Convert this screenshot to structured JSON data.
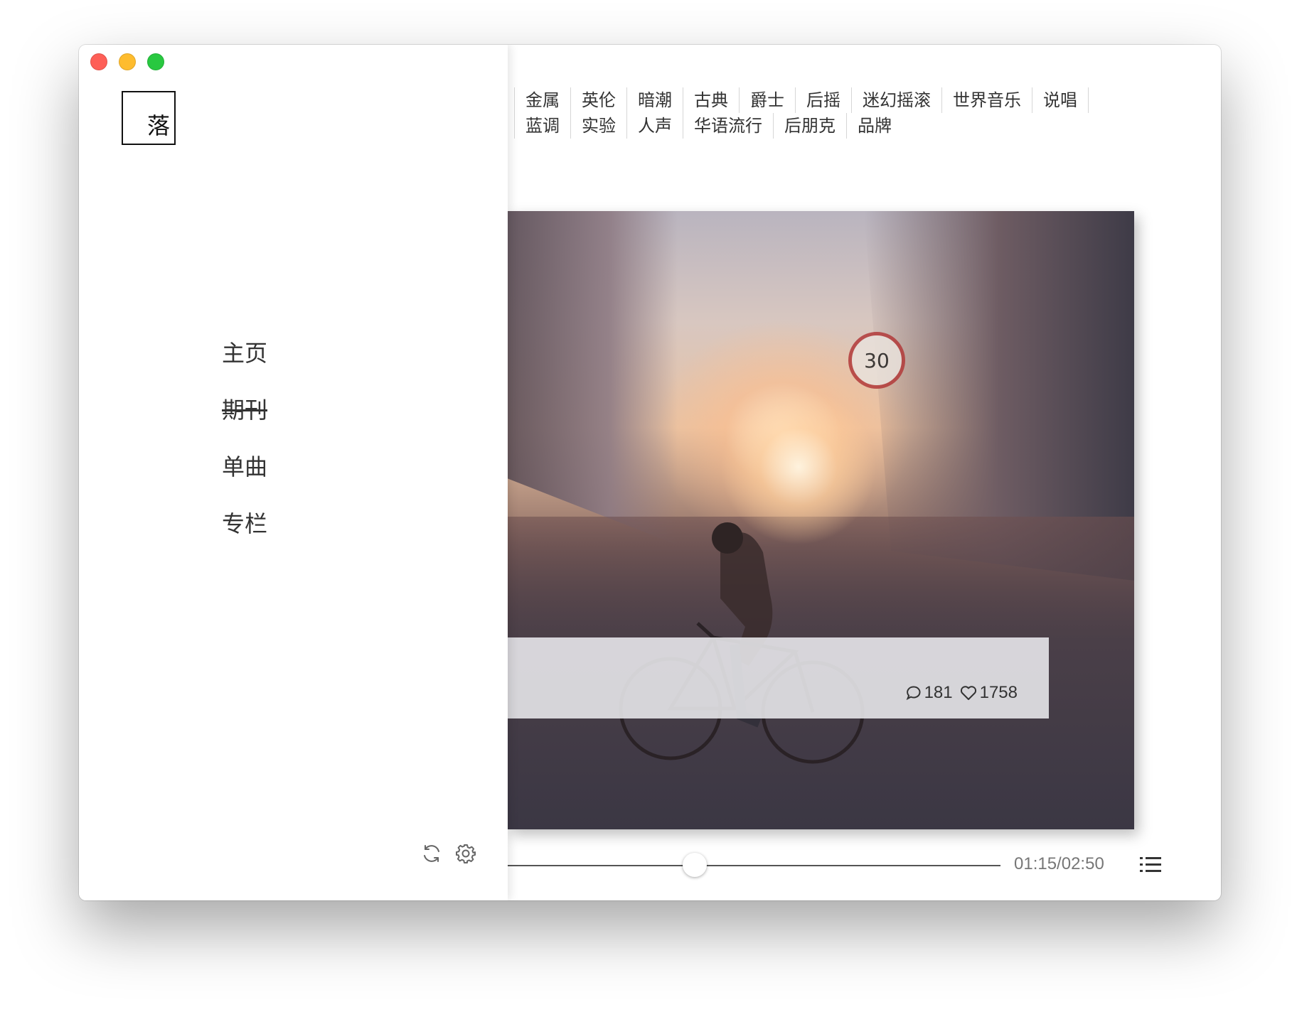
{
  "window": {
    "app_char": "落"
  },
  "genres": {
    "row1": [
      "金属",
      "英伦",
      "暗潮",
      "古典",
      "爵士",
      "后摇",
      "迷幻摇滚",
      "世界音乐",
      "说唱"
    ],
    "row2": [
      "蓝调",
      "实验",
      "人声",
      "华语流行",
      "后朋克",
      "品牌"
    ]
  },
  "nav": {
    "items": [
      "主页",
      "期刊",
      "单曲",
      "专栏"
    ],
    "active_index": 1
  },
  "cover": {
    "sign_text": "30",
    "comments": "181",
    "likes": "1758"
  },
  "player": {
    "time": "01:15/02:50",
    "progress": 0.38
  },
  "colors": {
    "accent_close": "#fe5f57",
    "accent_min": "#febc2e",
    "accent_max": "#28c840",
    "text": "#333333"
  },
  "icons": [
    "refresh-icon",
    "gear-icon",
    "comment-icon",
    "heart-icon",
    "playlist-icon"
  ]
}
